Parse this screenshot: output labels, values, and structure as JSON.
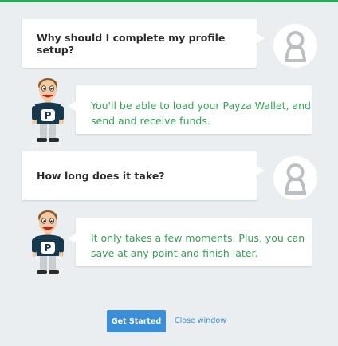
{
  "colors": {
    "accent_green": "#2bab5a",
    "answer_text": "#35a155",
    "button_blue": "#3a8fd8",
    "background": "#eaeef1"
  },
  "conversation": [
    {
      "question": "Why should I complete my profile setup?",
      "answer": "You'll be able to load your Payza Wallet, and send and receive funds."
    },
    {
      "question": "How long does it take?",
      "answer": "It only takes a few moments. Plus, you can save at any point and finish later."
    }
  ],
  "icons": {
    "user_avatar": "user-avatar-icon",
    "mascot": "payza-mascot-icon"
  },
  "mascot_badge": "P",
  "footer": {
    "primary_button": "Get Started",
    "secondary_link": "Close window"
  }
}
